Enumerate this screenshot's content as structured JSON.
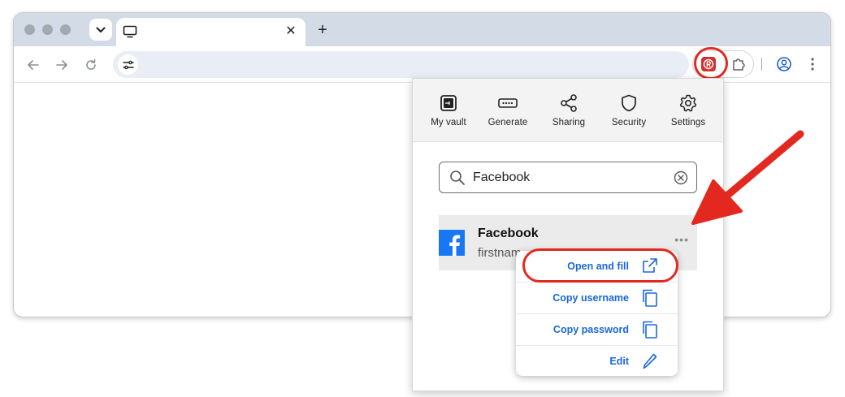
{
  "browser": {
    "tab": {
      "close_glyph": "✕"
    },
    "new_tab_glyph": "+",
    "toolbar": {
      "back_icon": "arrow-left-icon",
      "forward_icon": "arrow-right-icon",
      "reload_icon": "reload-icon",
      "address": ""
    }
  },
  "popup": {
    "nav": [
      {
        "label": "My vault",
        "icon": "vault-icon"
      },
      {
        "label": "Generate",
        "icon": "password-generator-icon"
      },
      {
        "label": "Sharing",
        "icon": "share-icon"
      },
      {
        "label": "Security",
        "icon": "shield-icon"
      },
      {
        "label": "Settings",
        "icon": "gear-icon"
      }
    ],
    "search": {
      "value": "Facebook"
    },
    "result": {
      "title": "Facebook",
      "subtitle": "firstnam",
      "more": "•••"
    },
    "menu": [
      {
        "label": "Open and fill",
        "icon": "open-external-icon"
      },
      {
        "label": "Copy username",
        "icon": "copy-icon"
      },
      {
        "label": "Copy password",
        "icon": "copy-icon"
      },
      {
        "label": "Edit",
        "icon": "pencil-icon"
      }
    ]
  },
  "colors": {
    "annotation": "#e3291f",
    "link": "#1a68d8",
    "facebook": "#1877f2",
    "extension": "#d32f2f"
  }
}
